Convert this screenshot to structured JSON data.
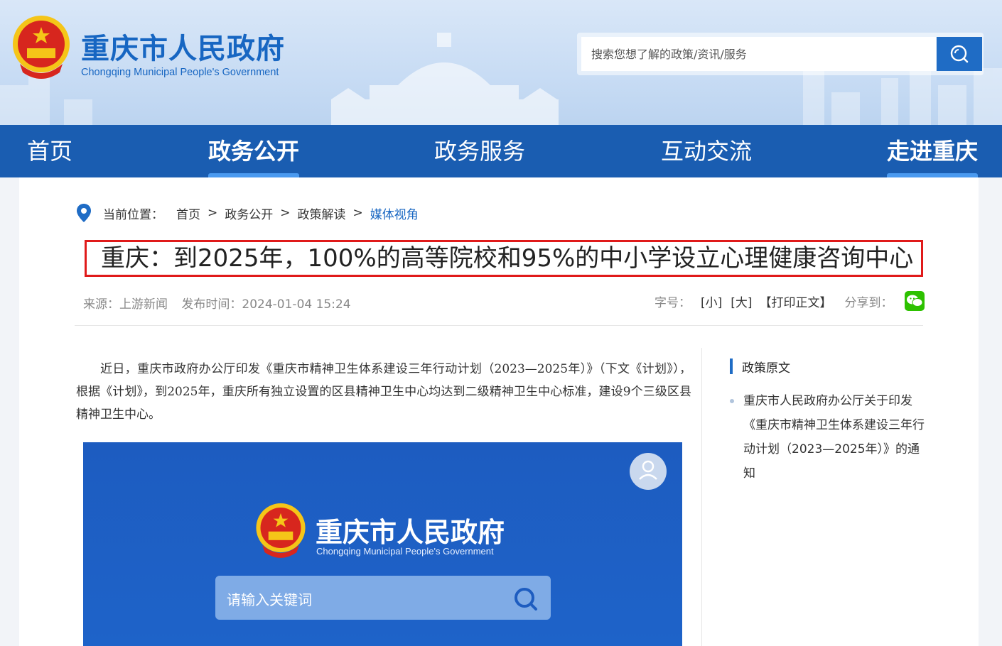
{
  "header": {
    "site_title": "重庆市人民政府",
    "site_subtitle": "Chongqing Municipal People's Government",
    "search_placeholder": "搜索您想了解的政策/资讯/服务"
  },
  "nav": {
    "items": [
      {
        "label": "首页"
      },
      {
        "label": "政务公开"
      },
      {
        "label": "政务服务"
      },
      {
        "label": "互动交流"
      },
      {
        "label": "走进重庆"
      }
    ]
  },
  "breadcrumb": {
    "prefix": "当前位置：",
    "items": [
      "首页",
      "政务公开",
      "政策解读",
      "媒体视角"
    ],
    "separator": ">"
  },
  "article": {
    "title": "重庆：到2025年，100%的高等院校和95%的中小学设立心理健康咨询中心",
    "source": "来源：上游新闻",
    "publish_time": "发布时间：2024-01-04 15:24",
    "font_size_label": "字号：",
    "font_small": "[小]",
    "font_large": "[大]",
    "print_label": "【打印正文】",
    "share_label": "分享到：",
    "body": "近日，重庆市政府办公厅印发《重庆市精神卫生体系建设三年行动计划（2023—2025年）》（下文《计划》），根据《计划》，到2025年，重庆所有独立设置的区县精神卫生中心均达到二级精神卫生中心标准，建设9个三级区县精神卫生中心。",
    "image": {
      "title": "重庆市人民政府",
      "subtitle": "Chongqing Municipal People's Government",
      "search_placeholder": "请输入关键词"
    }
  },
  "sidebar": {
    "heading": "政策原文",
    "items": [
      {
        "label": "重庆市人民政府办公厅关于印发《重庆市精神卫生体系建设三年行动计划（2023—2025年）》的通知"
      }
    ]
  },
  "colors": {
    "brand_blue": "#1766c2",
    "nav_blue": "#1a5db1",
    "highlight_red": "#e01a1a"
  }
}
